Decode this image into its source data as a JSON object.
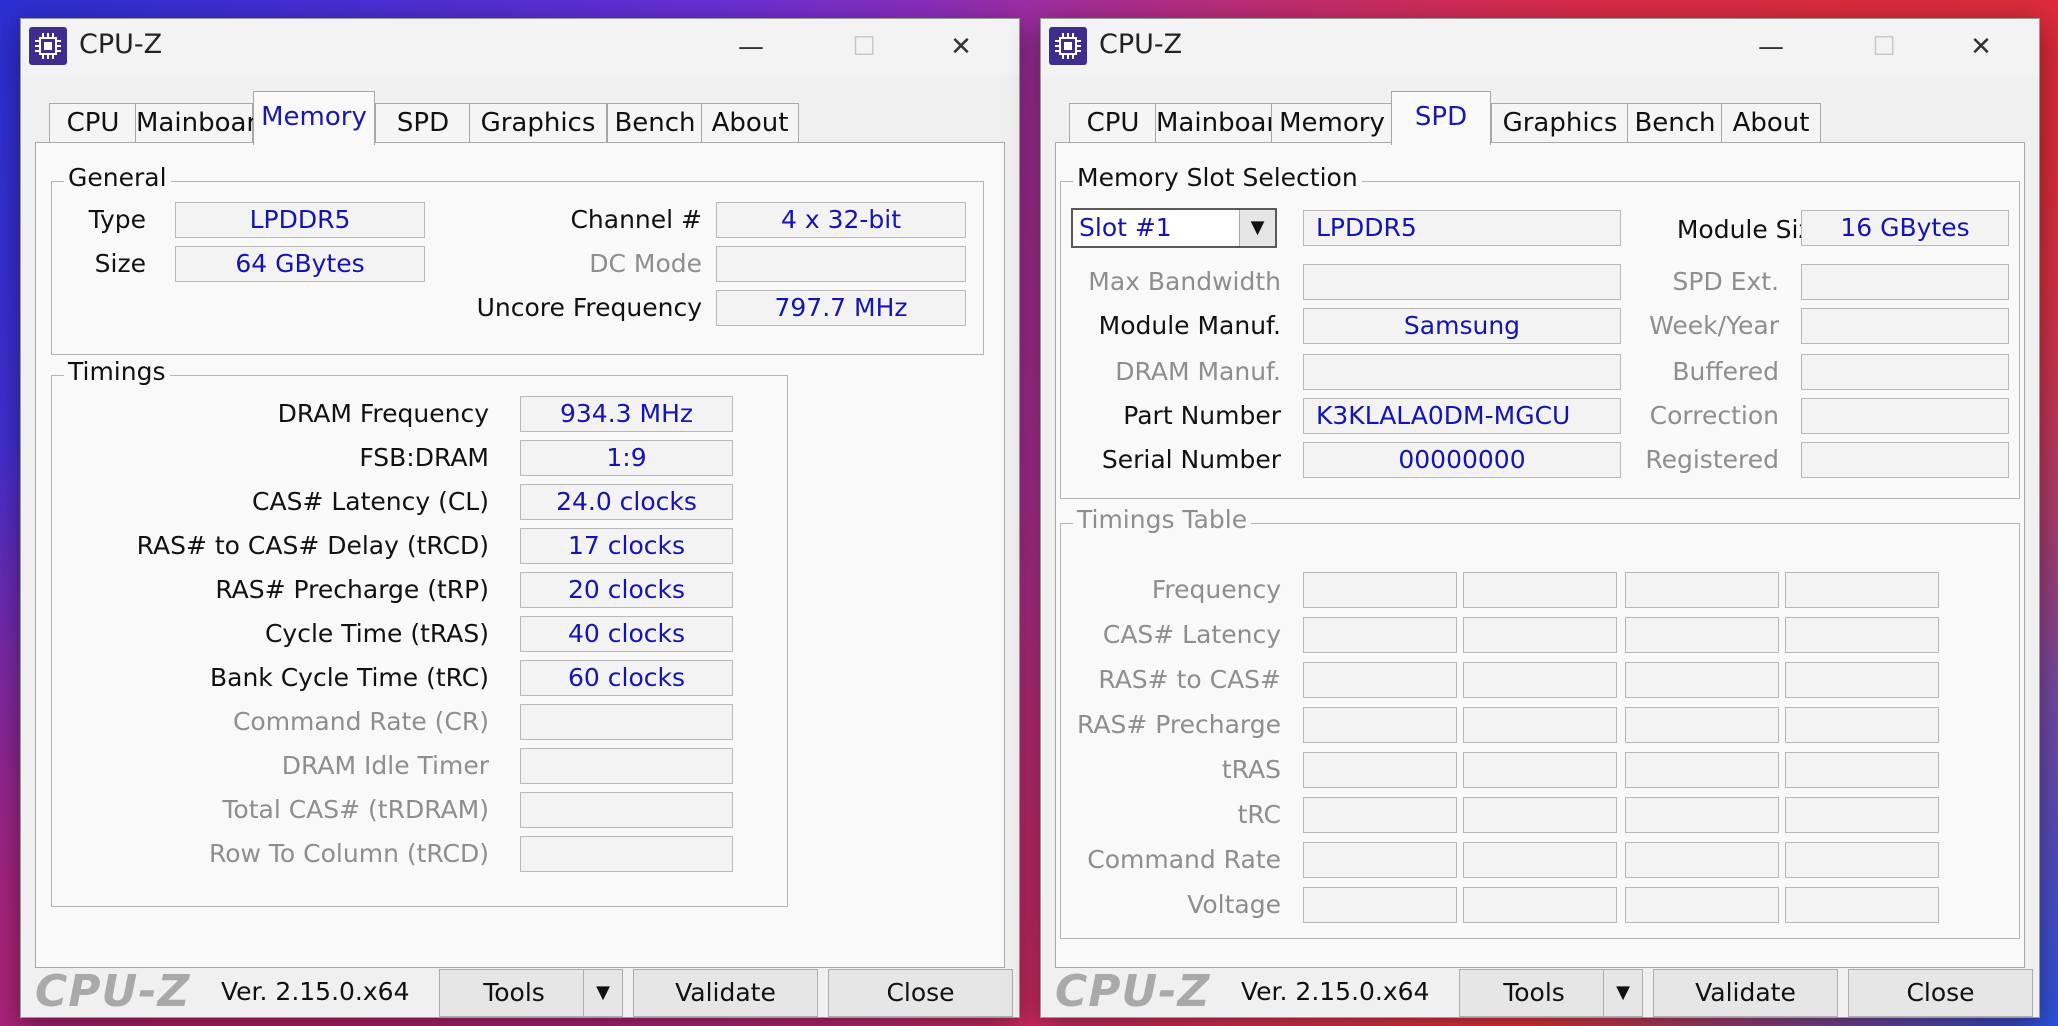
{
  "title": "CPU-Z",
  "version": "Ver. 2.15.0.x64",
  "logo": "CPU-Z",
  "titlebar_glyphs": {
    "minimize": "—",
    "maximize": "☐",
    "close": "✕"
  },
  "tabs": [
    "CPU",
    "Mainboard",
    "Memory",
    "SPD",
    "Graphics",
    "Bench",
    "About"
  ],
  "buttons": {
    "tools": "Tools",
    "validate": "Validate",
    "close": "Close",
    "dropdown_glyph": "▼"
  },
  "memory": {
    "active_tab": "Memory",
    "general": {
      "legend": "General",
      "type_label": "Type",
      "type_value": "LPDDR5",
      "size_label": "Size",
      "size_value": "64 GBytes",
      "channel_label": "Channel #",
      "channel_value": "4 x 32-bit",
      "dcmode_label": "DC Mode",
      "dcmode_value": "",
      "uncore_label": "Uncore Frequency",
      "uncore_value": "797.7 MHz"
    },
    "timings": {
      "legend": "Timings",
      "rows": [
        {
          "label": "DRAM Frequency",
          "value": "934.3 MHz"
        },
        {
          "label": "FSB:DRAM",
          "value": "1:9"
        },
        {
          "label": "CAS# Latency (CL)",
          "value": "24.0 clocks"
        },
        {
          "label": "RAS# to CAS# Delay (tRCD)",
          "value": "17 clocks"
        },
        {
          "label": "RAS# Precharge (tRP)",
          "value": "20 clocks"
        },
        {
          "label": "Cycle Time (tRAS)",
          "value": "40 clocks"
        },
        {
          "label": "Bank Cycle Time (tRC)",
          "value": "60 clocks"
        },
        {
          "label": "Command Rate (CR)",
          "value": ""
        },
        {
          "label": "DRAM Idle Timer",
          "value": ""
        },
        {
          "label": "Total CAS# (tRDRAM)",
          "value": ""
        },
        {
          "label": "Row To Column (tRCD)",
          "value": ""
        }
      ]
    }
  },
  "spd": {
    "active_tab": "SPD",
    "slot": {
      "legend": "Memory Slot Selection",
      "selected": "Slot #1",
      "type_value": "LPDDR5",
      "module_size_label": "Module Size",
      "module_size_value": "16 GBytes",
      "max_bandwidth_label": "Max Bandwidth",
      "max_bandwidth_value": "",
      "spd_ext_label": "SPD Ext.",
      "spd_ext_value": "",
      "module_manuf_label": "Module Manuf.",
      "module_manuf_value": "Samsung",
      "week_year_label": "Week/Year",
      "week_year_value": "",
      "dram_manuf_label": "DRAM Manuf.",
      "dram_manuf_value": "",
      "buffered_label": "Buffered",
      "buffered_value": "",
      "part_number_label": "Part Number",
      "part_number_value": "K3KLALA0DM-MGCU",
      "correction_label": "Correction",
      "correction_value": "",
      "serial_number_label": "Serial Number",
      "serial_number_value": "00000000",
      "registered_label": "Registered",
      "registered_value": ""
    },
    "timings_table": {
      "legend": "Timings Table",
      "rows": [
        "Frequency",
        "CAS# Latency",
        "RAS# to CAS#",
        "RAS# Precharge",
        "tRAS",
        "tRC",
        "Command Rate",
        "Voltage"
      ]
    }
  }
}
